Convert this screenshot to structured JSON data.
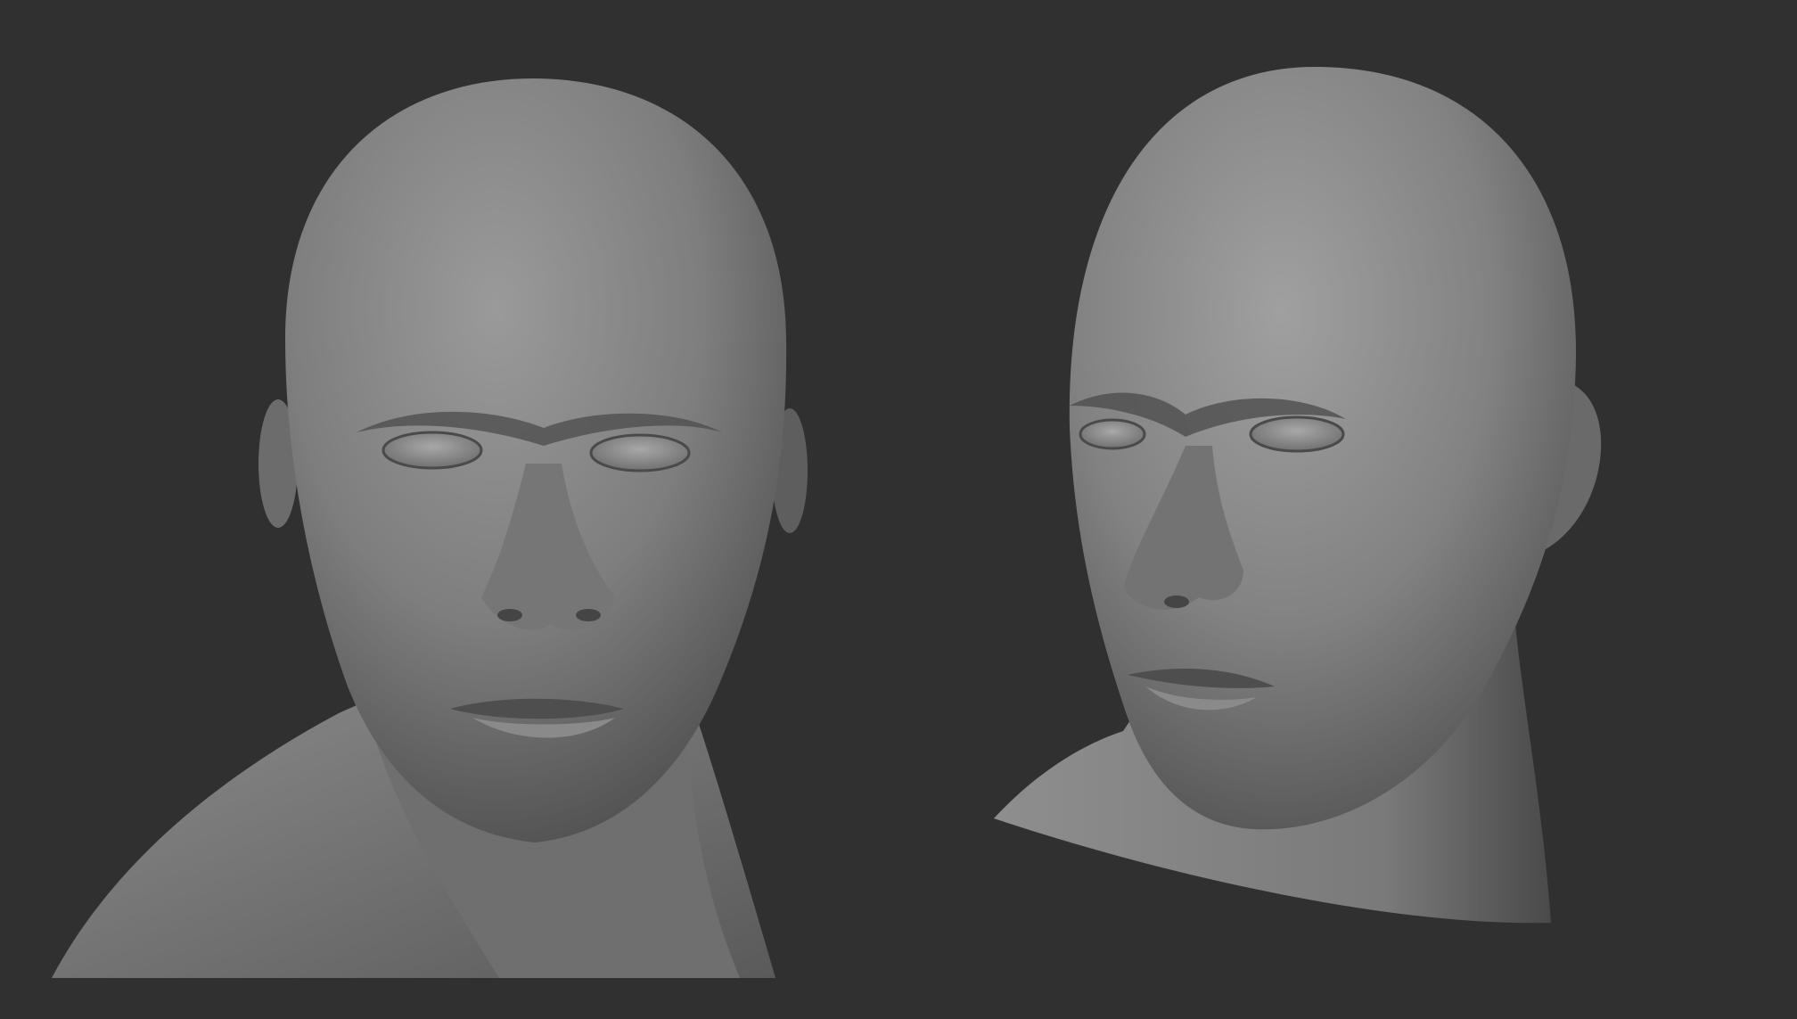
{
  "scene": {
    "background_color": "#303030",
    "material_color": "#8a8a8a",
    "views": [
      {
        "name": "front-view"
      },
      {
        "name": "three-quarter-view"
      }
    ]
  }
}
